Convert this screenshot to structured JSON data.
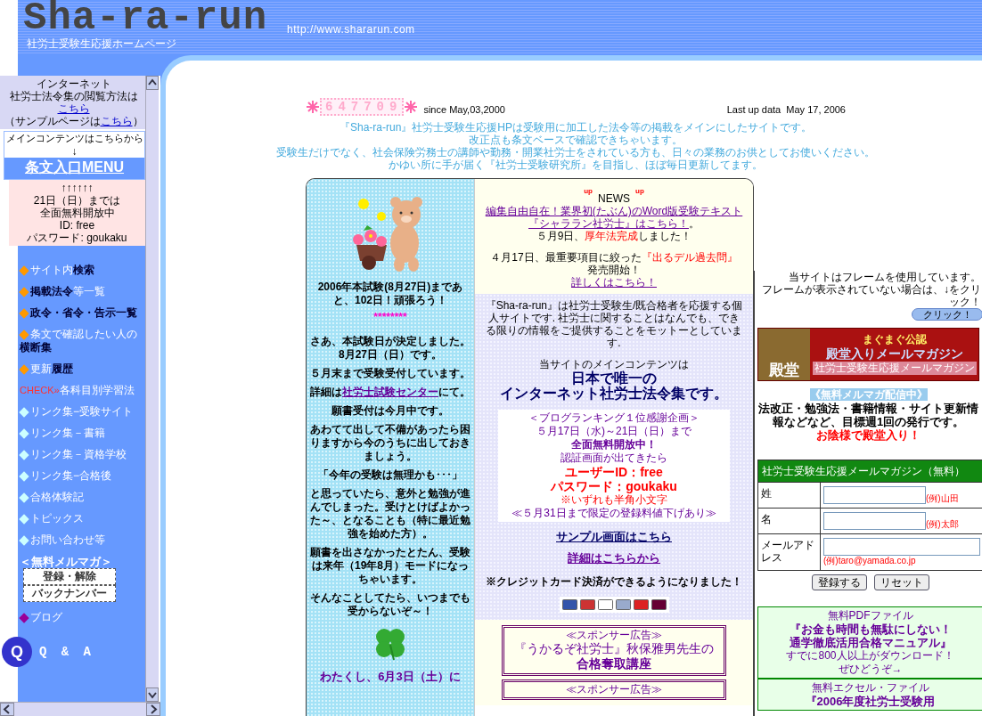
{
  "header": {
    "logo": "Sha-ra-run",
    "subtitle": "社労士受験生応援ホームページ",
    "url": "http://www.shararun.com"
  },
  "sidebar": {
    "browse_note": [
      [
        {
          "kind": "text",
          "text": "インターネット"
        }
      ],
      [
        {
          "kind": "text",
          "text": "社労士法令集の閲覧方法は"
        }
      ],
      [
        {
          "kind": "link",
          "text": "こちら"
        }
      ],
      [
        {
          "kind": "text",
          "text": "（サンプルページは"
        },
        {
          "kind": "link",
          "text": "こちら"
        },
        {
          "kind": "text",
          "text": "）"
        }
      ]
    ],
    "main_contents": {
      "label": "メインコンテンツはこちらから",
      "arrow": "↓",
      "link": "条文入口MENU"
    },
    "free_notice": [
      "↑↑↑↑↑↑",
      "21日（日）までは",
      "全面無料開放中",
      "ID: free",
      "パスワード: goukaku"
    ],
    "menu": [
      {
        "kind": "item",
        "label": "サイト内**検索**",
        "color": "#ff9900"
      },
      {
        "kind": "item",
        "label": "**掲載法令**等一覧",
        "color": "#ff9900"
      },
      {
        "kind": "item",
        "label": "**政令・省令・告示一覧**",
        "color": "#ff9900"
      },
      {
        "kind": "item",
        "label": "条文で確認したい人の**横断集**",
        "color": "#ff9900"
      },
      {
        "kind": "item",
        "label": "更新**履歴**",
        "color": "#ff9900"
      },
      {
        "kind": "check",
        "prefix": "CHECK»",
        "label": "各科目別学習法"
      },
      {
        "kind": "item",
        "label": "リンク集−受験サイト",
        "color": "#ccffff"
      },
      {
        "kind": "item",
        "label": "リンク集－書籍",
        "color": "#ccffff"
      },
      {
        "kind": "item",
        "label": "リンク集－資格学校",
        "color": "#ccffff"
      },
      {
        "kind": "item",
        "label": "リンク集−合格後",
        "color": "#ccffff"
      },
      {
        "kind": "item",
        "label": "合格体験記",
        "color": "#ccffff"
      },
      {
        "kind": "item",
        "label": "トピックス",
        "color": "#ccffff"
      },
      {
        "kind": "item",
        "label": "お問い合わせ等",
        "color": "#ccffff"
      }
    ],
    "mailmag": {
      "heading": "＜無料メルマガ＞",
      "buttons": [
        "登録・解除",
        "バックナンバー"
      ]
    },
    "blog": {
      "label": "ブログ",
      "color": "#990099"
    },
    "qa": {
      "badge": "Q",
      "label": "Q & A"
    }
  },
  "main": {
    "counter": "647709",
    "since": "since May,03,2000",
    "last_update": "Last up data  May 17, 2006",
    "intro": [
      "『Sha-ra-run』社労士受験生応援HPは受験用に加工した法令等の掲載をメインにしたサイトです。",
      "改正点も条文ベースで確認できちゃいます。",
      "受験生だけでなく、社会保険労務士の講師や勤務・開業社労士をされている方も、日々の業務のお供としてお使いください。",
      "かゆい所に手が届く『社労士受験研究所』を目指し、ほぼ毎日更新してます。"
    ],
    "left_column": {
      "paragraphs": [
        {
          "kind": "bold",
          "text": "2006年本試験(8月27日)まであと、102日！頑張ろう！"
        },
        {
          "kind": "stars",
          "text": "********"
        },
        {
          "kind": "boldgap",
          "text": "さあ、本試験日が決定しました。8月27日（日）です。"
        },
        {
          "kind": "bold",
          "text": "５月末まで受験受付しています。"
        },
        {
          "kind": "bold",
          "segments": [
            {
              "kind": "text",
              "text": "詳細は"
            },
            {
              "kind": "link",
              "text": "社労士試験センター"
            },
            {
              "kind": "text",
              "text": "にて。"
            }
          ]
        },
        {
          "kind": "bold",
          "text": "願書受付は今月中です。"
        },
        {
          "kind": "bold",
          "text": "あわてて出して不備があったら困りますから今のうちに出しておきましょう。"
        },
        {
          "kind": "bold",
          "text": "「今年の受験は無理かも･･･」"
        },
        {
          "kind": "bold",
          "text": "と思っていたら、意外と勉強が進んでしまった。受けとけばよかった～、となることも（特に最近勉強を始めた方）。"
        },
        {
          "kind": "bold",
          "text": "願書を出さなかったとたん、受験は来年（19年8月）モードになっちゃいます。"
        },
        {
          "kind": "bold",
          "text": "そんなことしてたら、いつまでも受からないぞ～！"
        }
      ],
      "closing": "わたくし、6月3日（土）に"
    },
    "news": {
      "marks": [
        "up",
        "up"
      ],
      "title": "NEWS",
      "paragraphs": [
        {
          "kind": "plain",
          "segments": [
            {
              "kind": "link",
              "text": "編集自由自在！業界初(たぶん)のWord版受験テキスト"
            }
          ]
        },
        {
          "kind": "plain",
          "segments": [
            {
              "kind": "link",
              "text": "『シャララン社労士』はこちら！"
            },
            {
              "kind": "text",
              "text": "。"
            }
          ]
        },
        {
          "kind": "plain",
          "segments": [
            {
              "kind": "text",
              "text": "５月9日、"
            },
            {
              "kind": "red",
              "text": "厚年法完成"
            },
            {
              "kind": "text",
              "text": "しました！"
            }
          ]
        },
        {
          "kind": "gap",
          "segments": [
            {
              "kind": "text",
              "text": "４月17日、最重要項目に絞った"
            },
            {
              "kind": "red",
              "text": "『出るデル過去問』"
            }
          ]
        },
        {
          "kind": "plain",
          "text": "発売開始！"
        },
        {
          "kind": "plain",
          "segments": [
            {
              "kind": "link",
              "text": "詳しくはこちら！"
            }
          ]
        }
      ]
    },
    "about": [
      {
        "kind": "plain",
        "text": "『Sha-ra-run』は社労士受験生/既合格者を応援する個人サイトです. 社労士に関することはなんでも、できる限りの情報をご提供することをモットーとしています."
      },
      {
        "kind": "gap",
        "text": "当サイトのメインコンテンツは"
      },
      {
        "kind": "big",
        "text": "日本で唯一の"
      },
      {
        "kind": "big",
        "text": "インターネット社労士法令集です。"
      }
    ],
    "promo": [
      {
        "kind": "pp",
        "text": "＜ブログランキング１位感謝企画＞"
      },
      {
        "kind": "pp",
        "text": "５月17日（水)～21日（日）まで"
      },
      {
        "kind": "ppb",
        "text": "全面無料開放中！"
      },
      {
        "kind": "pp",
        "text": "認証画面が出てきたら"
      },
      {
        "kind": "rb",
        "text": "ユーザーID：free"
      },
      {
        "kind": "rb",
        "text": "パスワード：goukaku"
      },
      {
        "kind": "red",
        "text": "※いずれも半角小文字"
      },
      {
        "kind": "pp",
        "text": "≪５月31日まで限定の登録料値下げあり≫"
      }
    ],
    "after_promo": [
      {
        "kind": "gap",
        "segments": [
          {
            "kind": "link_navy",
            "text": "サンプル画面はこちら"
          }
        ]
      },
      {
        "kind": "gap",
        "segments": [
          {
            "kind": "link_bold",
            "text": "詳細はこちらから"
          }
        ]
      },
      {
        "kind": "boldgap",
        "text": "※クレジットカード決済ができるようになりました！"
      }
    ],
    "sponsors": [
      {
        "label": "≪スポンサー広告≫",
        "text": "『うかるぞ社労士』秋保雅男先生の",
        "title": "合格奪取講座"
      },
      {
        "label": "≪スポンサー広告≫"
      }
    ],
    "right_column": {
      "frame_note": [
        "当サイトはフレームを使用しています。",
        "フレームが表示されていない場合は、↓をクリック！"
      ],
      "click_button": "クリック！",
      "banner": {
        "badge": "殿堂",
        "tag": "まぐまぐ公認",
        "title": "殿堂入りメールマガジン",
        "subtitle": "社労士受験生応援メールマガジン"
      },
      "mailmag": {
        "label": "《無料メルマガ配信中》",
        "description": "法改正・勉強法・書籍情報・サイト更新情報などなど、目標週1回の発行です。",
        "award": "お陰様で殿堂入り！"
      },
      "form": {
        "title": "社労士受験生応援メールマガジン（無料）",
        "fields": [
          {
            "kind": "inline",
            "label": "姓",
            "example": "(例)山田"
          },
          {
            "kind": "inline",
            "label": "名",
            "example": "(例)太郎"
          },
          {
            "kind": "wide",
            "label": "メールアドレス",
            "example": "(例)taro@yamada.co.jp"
          }
        ],
        "buttons": [
          "登録する",
          "リセット"
        ]
      },
      "downloads": [
        {
          "lines": [
            {
              "kind": "plain",
              "text": "無料PDFファイル"
            },
            {
              "kind": "bold",
              "text": "『お金も時間も無駄にしない！"
            },
            {
              "kind": "bold",
              "text": "通学徹底活用合格マニュアル』"
            },
            {
              "kind": "plain",
              "text": "すでに800人以上がダウンロード！"
            },
            {
              "kind": "plain",
              "text": "ぜひどうぞ→"
            }
          ]
        },
        {
          "lines": [
            {
              "kind": "plain",
              "text": "無料エクセル・ファイル"
            },
            {
              "kind": "bold",
              "text": "『2006年度社労士受験用"
            }
          ]
        }
      ]
    }
  }
}
